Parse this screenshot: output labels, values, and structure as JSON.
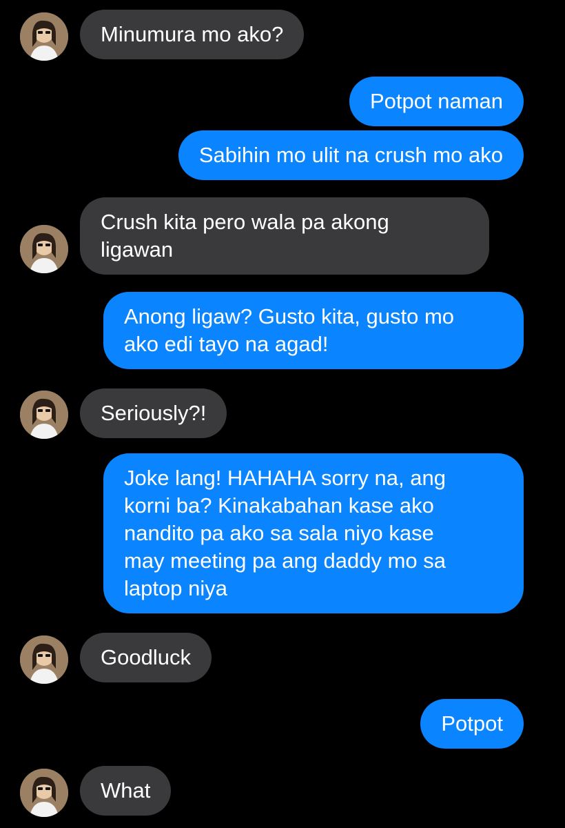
{
  "colors": {
    "background": "#000000",
    "incoming_bubble": "#3a3a3c",
    "outgoing_bubble": "#0a84ff",
    "text": "#ffffff"
  },
  "avatar_icon": "contact-avatar-photo",
  "messages": [
    {
      "direction": "in",
      "text": "Minumura mo ako?"
    },
    {
      "direction": "out",
      "text": "Potpot naman"
    },
    {
      "direction": "out",
      "text": "Sabihin mo ulit na crush mo ako"
    },
    {
      "direction": "in",
      "text": "Crush kita pero wala pa akong\nligawan"
    },
    {
      "direction": "out",
      "text": "Anong ligaw? Gusto kita, gusto mo\nako edi tayo na agad!"
    },
    {
      "direction": "in",
      "text": "Seriously?!"
    },
    {
      "direction": "out",
      "text": "Joke lang! HAHAHA sorry na, ang\nkorni ba? Kinakabahan kase ako\nnandito pa ako sa sala niyo kase\nmay meeting pa ang daddy mo sa\nlaptop niya"
    },
    {
      "direction": "in",
      "text": "Goodluck"
    },
    {
      "direction": "out",
      "text": "Potpot"
    },
    {
      "direction": "in",
      "text": "What"
    }
  ]
}
